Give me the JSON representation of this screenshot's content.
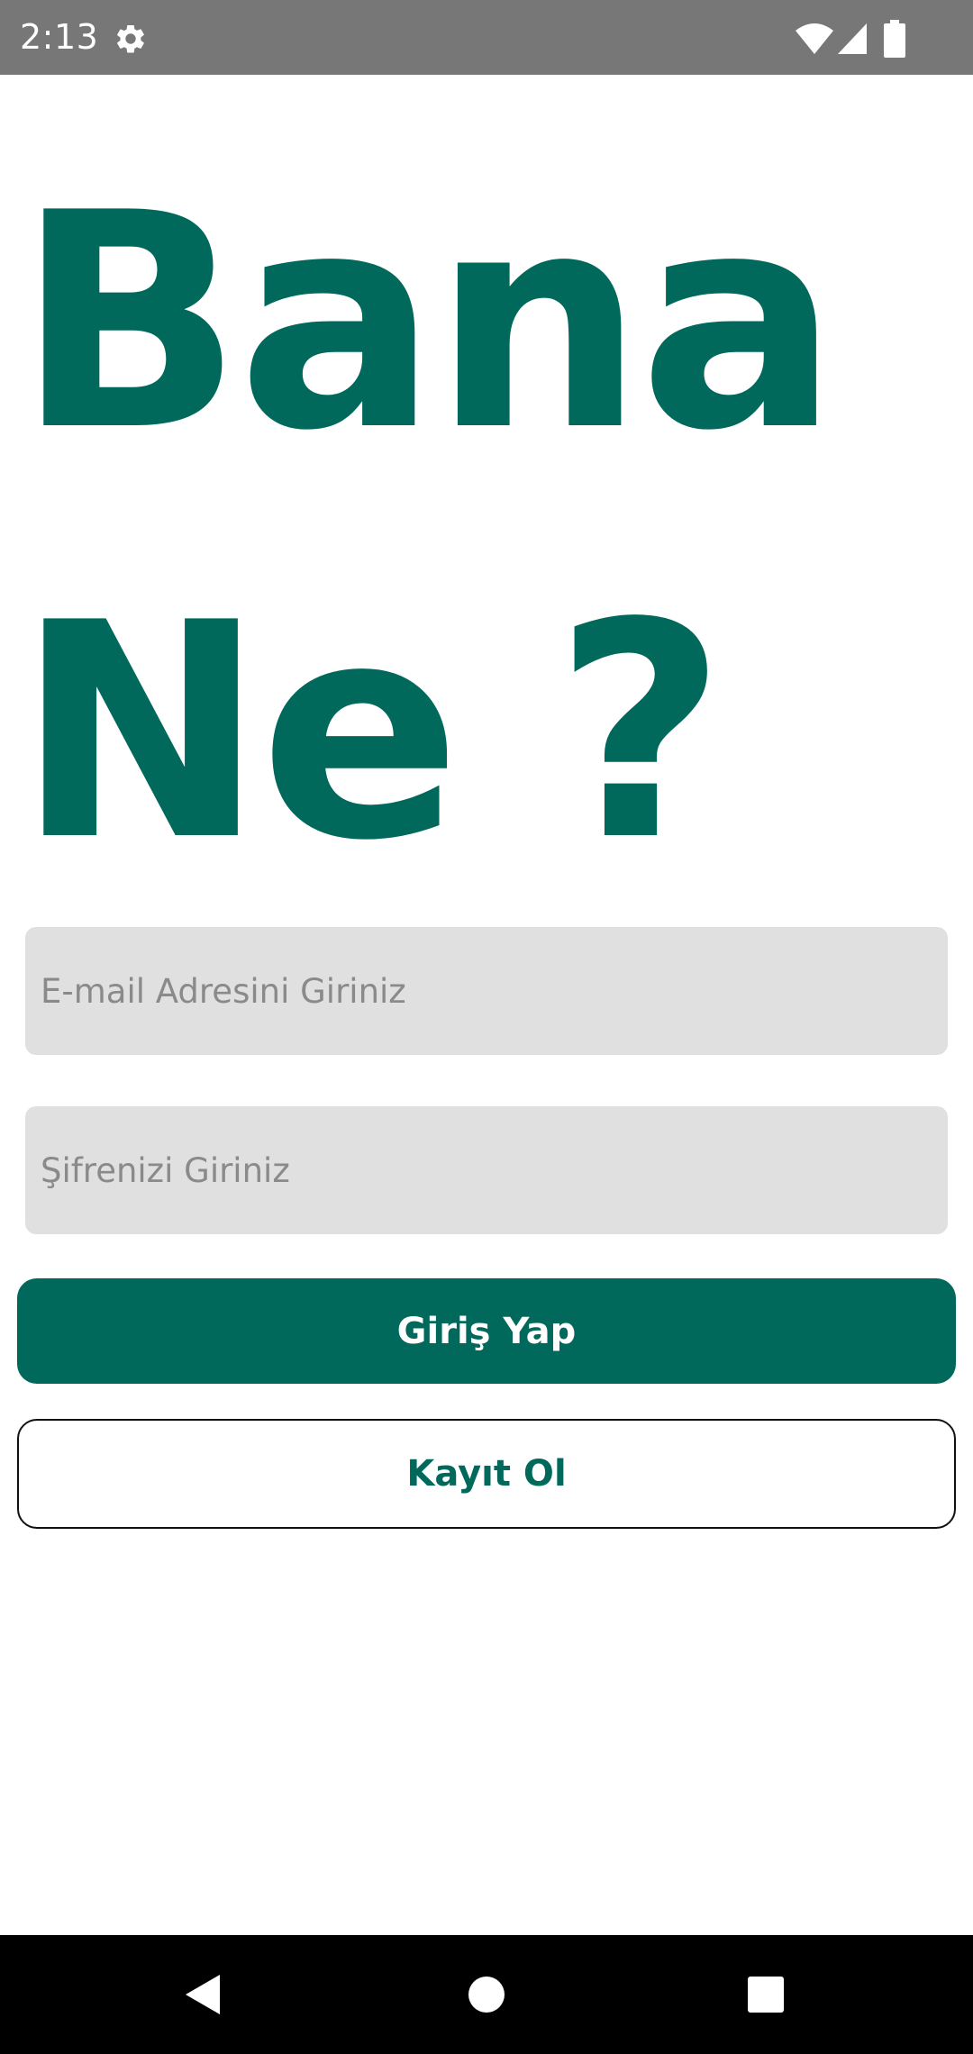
{
  "status_bar": {
    "time": "2:13",
    "icons": [
      "gear-icon",
      "wifi-icon",
      "signal-icon",
      "battery-icon"
    ]
  },
  "title": {
    "line1": "Bana",
    "line2": "Ne ?"
  },
  "form": {
    "email_placeholder": "E-mail Adresini Giriniz",
    "email_value": "",
    "password_placeholder": "Şifrenizi Giriniz",
    "password_value": ""
  },
  "buttons": {
    "login_label": "Giriş Yap",
    "register_label": "Kayıt Ol"
  },
  "nav_bar": {
    "icons": [
      "back-icon",
      "home-icon",
      "recents-icon"
    ]
  },
  "colors": {
    "primary": "#00695c",
    "status_bar": "#777777",
    "input_bg": "#e0e0e0",
    "nav_bar": "#000000"
  }
}
